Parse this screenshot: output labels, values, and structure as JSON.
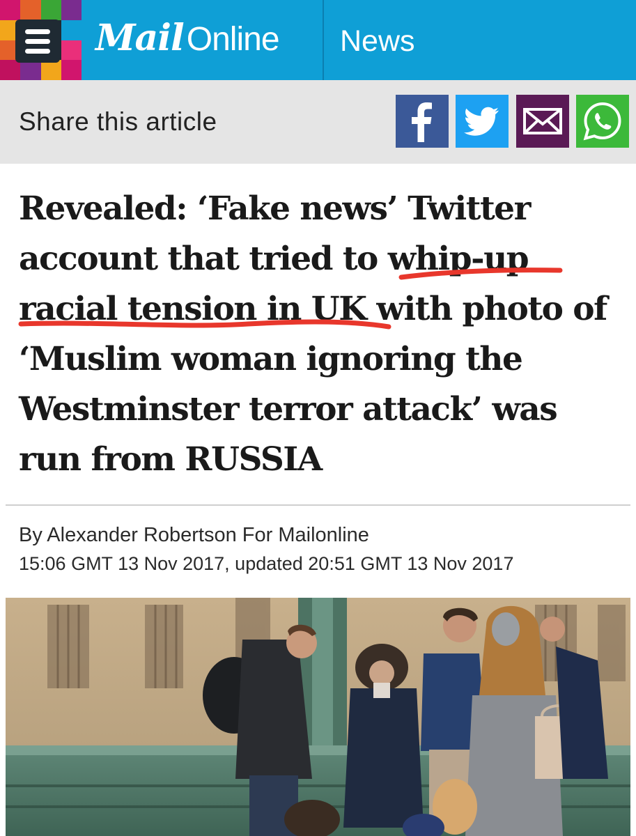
{
  "header": {
    "logo_mail": "Mail",
    "logo_online": "Online",
    "section": "News",
    "mosaic_colors": [
      "#d1156d",
      "#e4612a",
      "#3aa636",
      "#7a2c8f",
      "#f2a61b",
      "#1f2a33",
      "#1f2a33",
      "#0f9fd6",
      "#e4612a",
      "#1f2a33",
      "#1f2a33",
      "#ea2f7a",
      "#c0115e",
      "#7a2c8f",
      "#f2a61b",
      "#d1156d"
    ]
  },
  "share": {
    "label": "Share this article",
    "buttons": [
      {
        "name": "facebook",
        "icon": "facebook-icon",
        "color": "#3b5998"
      },
      {
        "name": "twitter",
        "icon": "twitter-icon",
        "color": "#1da1f2"
      },
      {
        "name": "email",
        "icon": "email-icon",
        "color": "#5a1a55"
      },
      {
        "name": "whatsapp",
        "icon": "whatsapp-icon",
        "color": "#3cb93a"
      }
    ]
  },
  "article": {
    "headline": "Revealed: ‘Fake news’ Twitter account that tried to whip-up racial tension in UK with photo of ‘Muslim woman ignoring the Westminster terror attack’ was run from RUSSIA",
    "underline_color": "#e8372c",
    "byline": "By Alexander Robertson For Mailonline",
    "dateline": "15:06 GMT 13 Nov 2017, updated 20:51 GMT 13 Nov 2017"
  },
  "photo": {
    "icon": "news-photo"
  }
}
